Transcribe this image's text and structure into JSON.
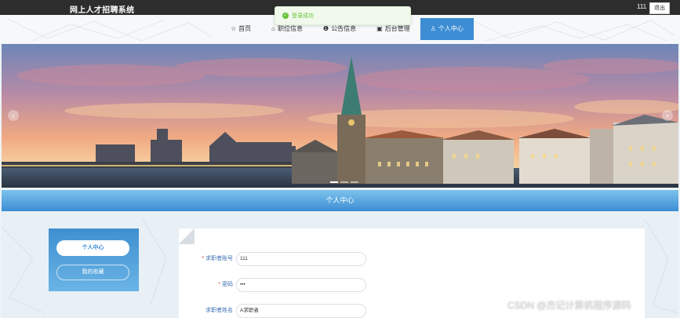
{
  "header": {
    "site_title": "网上人才招聘系统",
    "user_name": "111",
    "logout_label": "退出"
  },
  "toast": {
    "message": "登录成功",
    "color": "#67c23a"
  },
  "nav": {
    "items": [
      {
        "label": "首页",
        "icon": "star-icon"
      },
      {
        "label": "职位信息",
        "icon": "bag-icon"
      },
      {
        "label": "公告信息",
        "icon": "info-icon"
      },
      {
        "label": "后台管理",
        "icon": "briefcase-icon"
      },
      {
        "label": "个人中心",
        "icon": "user-icon"
      }
    ],
    "active_index": 4,
    "accent": "#3c8dd4"
  },
  "section": {
    "title": "个人中心"
  },
  "sidebar": {
    "items": [
      {
        "label": "个人中心"
      },
      {
        "label": "我的收藏"
      }
    ]
  },
  "form": {
    "fields": [
      {
        "label": "求职者账号",
        "required": true,
        "value": "111"
      },
      {
        "label": "密码",
        "required": true,
        "value": "•••"
      },
      {
        "label": "求职者姓名",
        "required": false,
        "value": "A求职者"
      }
    ]
  },
  "watermark": "CSDN @杰记计算机程序源码"
}
